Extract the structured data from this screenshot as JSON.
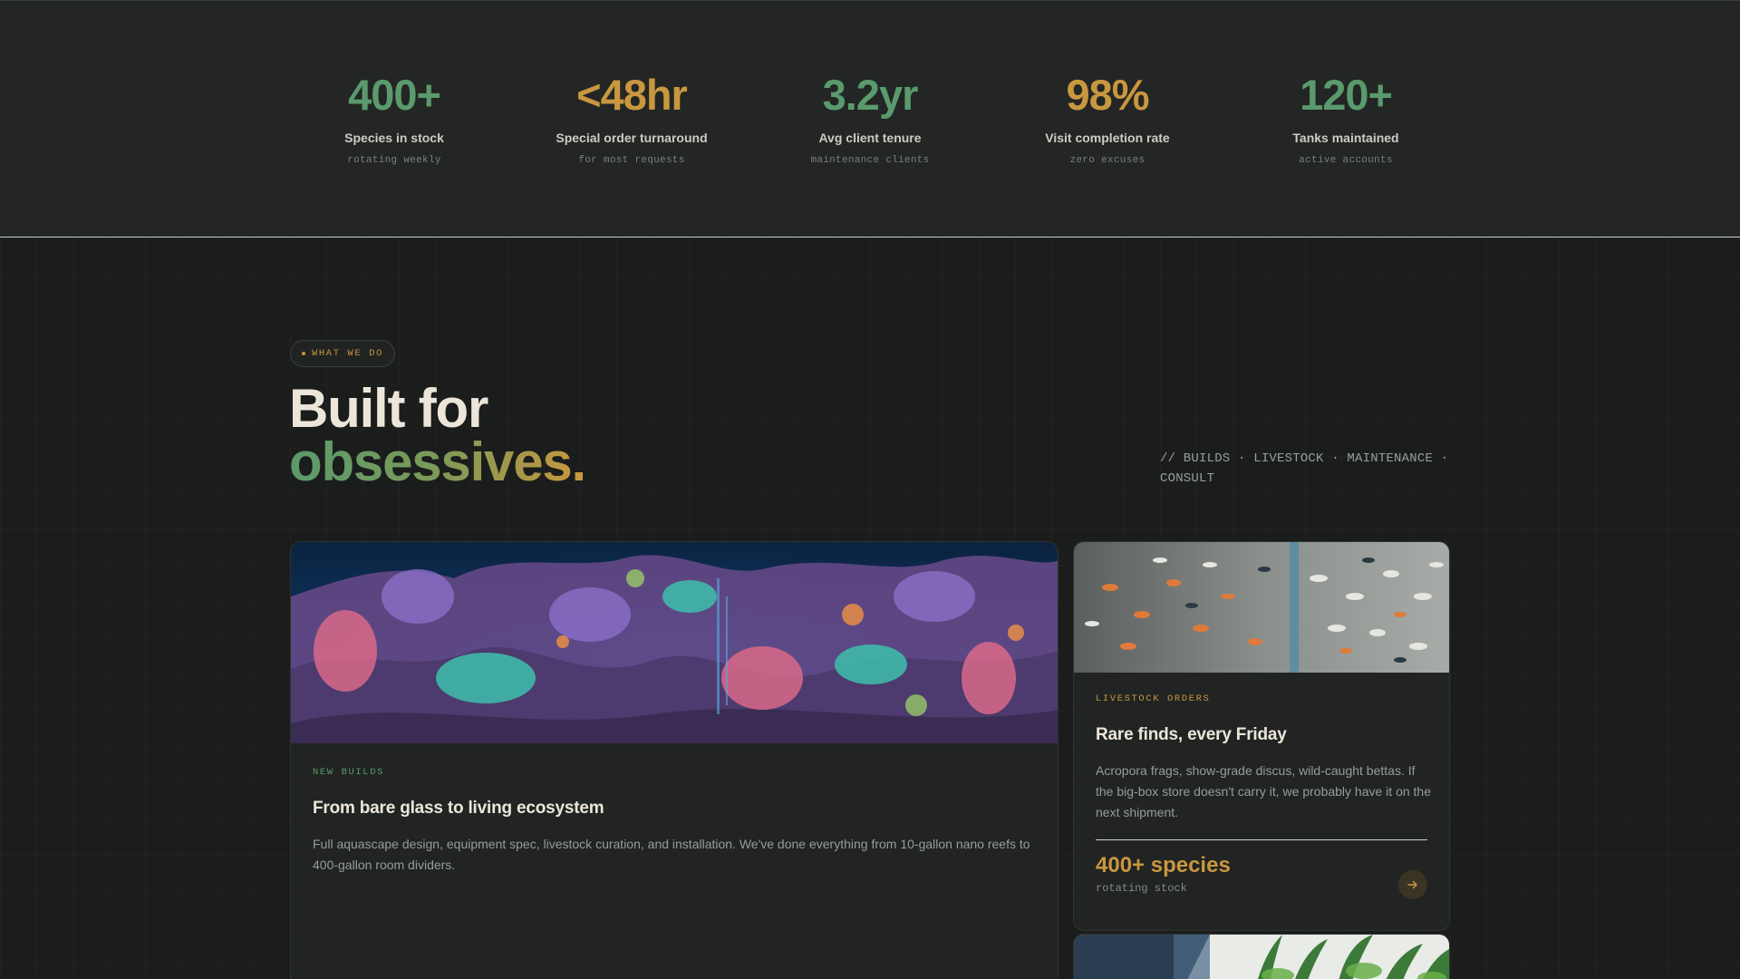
{
  "stats": [
    {
      "value": "400+",
      "label": "Species in stock",
      "note": "rotating weekly",
      "color": "#5a9a6c"
    },
    {
      "value": "<48hr",
      "label": "Special order turnaround",
      "note": "for most requests",
      "color": "#c9973f"
    },
    {
      "value": "3.2yr",
      "label": "Avg client tenure",
      "note": "maintenance clients",
      "color": "#5a9a6c"
    },
    {
      "value": "98%",
      "label": "Visit completion rate",
      "note": "zero excuses",
      "color": "#c9973f"
    },
    {
      "value": "120+",
      "label": "Tanks maintained",
      "note": "active accounts",
      "color": "#5a9a6c"
    }
  ],
  "section": {
    "eyebrow": "WHAT WE DO",
    "headline_line1": "Built for",
    "headline_line2": "obsessives.",
    "tagline": "// BUILDS · LIVESTOCK · MAINTENANCE · CONSULT"
  },
  "cards": {
    "builds": {
      "kicker": "NEW BUILDS",
      "title": "From bare glass to living ecosystem",
      "description": "Full aquascape design, equipment spec, livestock curation, and installation. We've done everything from 10-gallon nano reefs to 400-gallon room dividers.",
      "image": "coral-reef-aquarium-photo"
    },
    "livestock": {
      "kicker": "LIVESTOCK ORDERS",
      "title": "Rare finds, every Friday",
      "description": "Acropora frags, show-grade discus, wild-caught bettas. If the big-box store doesn't carry it, we probably have it on the next shipment.",
      "stat": "400+ species",
      "stat_note": "rotating stock",
      "image": "schooling-fish-tank-photo",
      "button_icon": "arrow-right-icon"
    },
    "maintenance": {
      "image": "planted-tank-maintenance-photo"
    }
  },
  "colors": {
    "green": "#5a9a6c",
    "amber": "#c9973f",
    "background": "#1a1d1b",
    "panel": "#232624"
  }
}
